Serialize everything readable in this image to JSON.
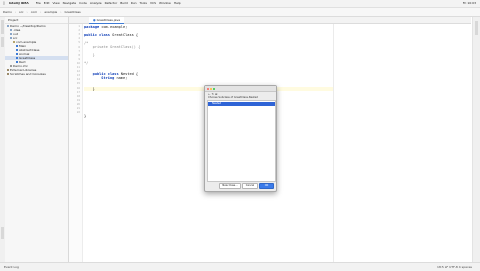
{
  "menubar": {
    "app": "IntelliJ IDEA",
    "items": [
      "File",
      "Edit",
      "View",
      "Navigate",
      "Code",
      "Analyze",
      "Refactor",
      "Build",
      "Run",
      "Tools",
      "VCS",
      "Window",
      "Help"
    ],
    "right": "Fri 10:03"
  },
  "navbar": {
    "crumbs": [
      "Demo",
      "src",
      "com",
      "example",
      "GreatClass"
    ]
  },
  "project_panel": {
    "header": "Project",
    "items": [
      {
        "label": "Demo  ~/Desktop/Demo",
        "indent": 0,
        "selected": false,
        "icon": "folder-icon"
      },
      {
        "label": ".idea",
        "indent": 1,
        "selected": false,
        "icon": "folder-icon"
      },
      {
        "label": "out",
        "indent": 1,
        "selected": false,
        "icon": "folder-icon"
      },
      {
        "label": "src",
        "indent": 1,
        "selected": false,
        "icon": "folder-icon"
      },
      {
        "label": "com.example",
        "indent": 2,
        "selected": false,
        "icon": "package-icon"
      },
      {
        "label": "Main",
        "indent": 3,
        "selected": false,
        "icon": "class-icon"
      },
      {
        "label": "AbstractClass",
        "indent": 3,
        "selected": false,
        "icon": "class-icon"
      },
      {
        "label": "Animal",
        "indent": 3,
        "selected": false,
        "icon": "class-icon"
      },
      {
        "label": "GreatClass",
        "indent": 3,
        "selected": true,
        "icon": "class-icon"
      },
      {
        "label": "Rect",
        "indent": 3,
        "selected": false,
        "icon": "class-icon"
      },
      {
        "label": "Demo.iml",
        "indent": 1,
        "selected": false,
        "icon": "file-icon"
      },
      {
        "label": "External Libraries",
        "indent": 0,
        "selected": false,
        "icon": "library-icon"
      },
      {
        "label": "Scratches and Consoles",
        "indent": 0,
        "selected": false,
        "icon": "scratch-icon"
      }
    ]
  },
  "editor": {
    "tab_label": "GreatClass.java",
    "line_numbers": [
      "1",
      "2",
      "3",
      "4",
      "5",
      "6",
      "7",
      "8",
      "9",
      "10",
      "11",
      "12",
      "13",
      "14",
      "15",
      "16",
      "17",
      "18",
      "19",
      "20",
      "21",
      "22"
    ],
    "code": {
      "l1_kw": "package",
      "l1_rest": " com.example;",
      "l3_kw": "public class",
      "l3_rest": " GreatClass {",
      "l5": "/*",
      "l6": "    private GreatClass() {",
      "l8": "    }",
      "l9": "*/",
      "l11_kw": "    public class",
      "l11_rest": " Nested {",
      "l12_kw": "        String",
      "l12_rest": " name;",
      "l14": "    }",
      "l16": "}"
    }
  },
  "dialog": {
    "toolbar": "←  ↻  ⊞",
    "caption": "Choose Subclass of GreatClass.Nested",
    "selected_row": "Nested",
    "buttons": {
      "cancel_label": "Cancel",
      "ok_label": "OK",
      "new_label": "New Class..."
    }
  },
  "statusbar": {
    "left": "Event Log",
    "right": "18:5  LF  UTF-8  4 spaces"
  },
  "colors": {
    "accent": "#2f64d6",
    "keyword": "#0033b3",
    "comment": "#8c8c8c"
  }
}
